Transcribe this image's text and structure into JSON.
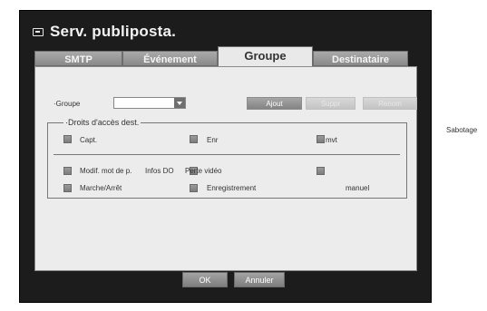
{
  "window": {
    "title": "Serv. publiposta."
  },
  "tabs": [
    {
      "label": "SMTP",
      "active": false
    },
    {
      "label": "Événement",
      "active": false
    },
    {
      "label": "Groupe",
      "active": true
    },
    {
      "label": "Destinataire",
      "active": false
    }
  ],
  "group": {
    "label": "·Groupe",
    "selected_value": ""
  },
  "buttons": {
    "add": "Ajout",
    "delete": "Suppr",
    "rename": "Renom"
  },
  "rights": {
    "title": "·Droits d'accès dest.",
    "row1": [
      {
        "label": "Capt."
      },
      {
        "label": "Enr"
      },
      {
        "label": "mvt"
      }
    ],
    "outside_label": "Sabotage",
    "row2": [
      {
        "label": "Modif. mot de p."
      },
      {
        "label": "Infos DO"
      },
      {
        "label": "Perte vidéo"
      },
      {
        "label": ""
      }
    ],
    "row3": [
      {
        "label": "Marche/Arrêt"
      },
      {
        "label": "Enregistrement"
      },
      {
        "label": "manuel"
      }
    ]
  },
  "footer": {
    "ok": "OK",
    "cancel": "Annuler"
  },
  "colors": {
    "window_bg": "#1c1c1c",
    "panel_bg": "#ececec",
    "tab_inactive": "#9a9a9a"
  }
}
